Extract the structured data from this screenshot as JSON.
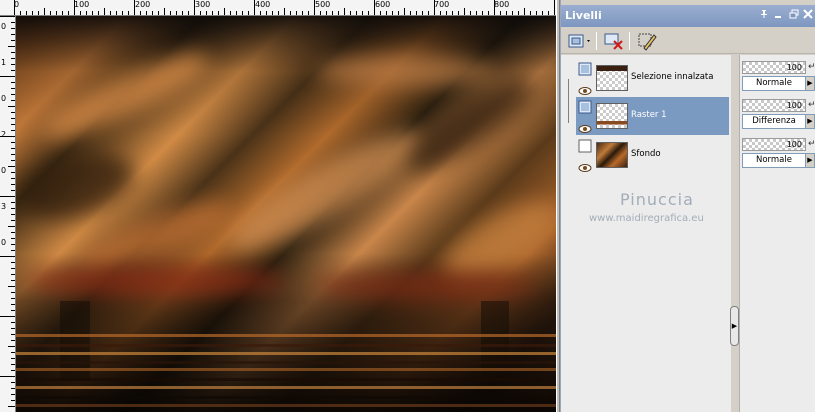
{
  "ruler": {
    "top_labels": [
      "0",
      "100",
      "200",
      "300",
      "400",
      "500",
      "600",
      "700",
      "800"
    ],
    "left_labels": [
      "0",
      "1",
      "0",
      "2",
      "0",
      "3",
      "0"
    ]
  },
  "layers_panel": {
    "title": "Livelli",
    "title_buttons": [
      "pin-icon",
      "minimize-icon",
      "restore-icon",
      "close-icon"
    ],
    "toolbar": [
      "new-layer-icon",
      "delete-layer-icon",
      "edit-selection-icon"
    ],
    "layers": [
      {
        "name": "Selezione innalzata",
        "selected": false,
        "opacity": "100",
        "blend": "Normale"
      },
      {
        "name": "Raster 1",
        "selected": true,
        "opacity": "100",
        "blend": "Differenza"
      },
      {
        "name": "Sfondo",
        "selected": false,
        "opacity": "100",
        "blend": "Normale"
      }
    ]
  },
  "watermark": {
    "title": "Pinuccia",
    "url": "www.maidiregrafica.eu"
  },
  "colors": {
    "panel_bg": "#d4d0c8",
    "titlebar": "#7e97c0",
    "selected_row": "#7b9ac1"
  }
}
